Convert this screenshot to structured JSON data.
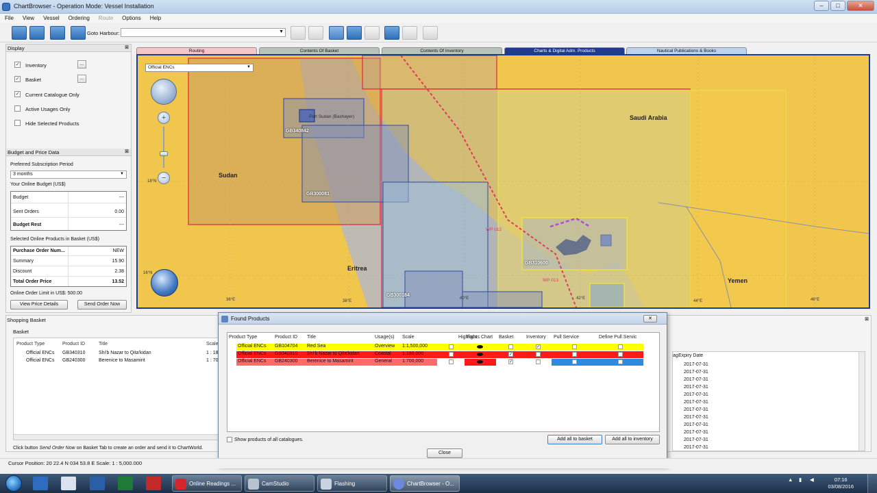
{
  "window": {
    "title": "ChartBrowser - Operation Mode: Vessel Installation",
    "minimize": "–",
    "maximize": "□",
    "close": "✕"
  },
  "menu": [
    "File",
    "View",
    "Vessel",
    "Ordering",
    "Route",
    "Options",
    "Help"
  ],
  "toolbar": {
    "goto_label": "Goto Harbour:",
    "goto_value": ""
  },
  "display_panel": {
    "title": "Display",
    "pin": "⊠",
    "options": [
      {
        "label": "Inventory",
        "checked": true
      },
      {
        "label": "Basket",
        "checked": true
      },
      {
        "label": "Current Catalogue Only",
        "checked": true
      },
      {
        "label": "Active Usages Only",
        "checked": false
      },
      {
        "label": "Hide Selected Products",
        "checked": false
      }
    ],
    "dots": "..."
  },
  "budget_panel": {
    "title": "Budget and Price Data",
    "period_label": "Preferred Subscription Period",
    "period_value": "3 months",
    "budget_label": "Your Online Budget (US$)",
    "budget_rows": [
      {
        "k": "Budget",
        "v": "---"
      },
      {
        "k": "Sent Orders",
        "v": "0.00"
      },
      {
        "k": "Budget Rest",
        "v": "---"
      }
    ],
    "selected_label": "Selected Online Products in Basket (US$)",
    "selected_rows": [
      {
        "k": "Purchase Order Num...",
        "v": "NEW"
      },
      {
        "k": "Summary",
        "v": "15.90"
      },
      {
        "k": "Discount",
        "v": "2.38"
      },
      {
        "k": "Total Order Price",
        "v": "13.52"
      }
    ],
    "limit_label": "Online Order Limit in US$: 500.00",
    "view_price_btn": "View Price Details",
    "send_order_btn": "Send Order Now"
  },
  "tabs": [
    {
      "label": "Routing",
      "color": "#f4c6c6"
    },
    {
      "label": "Contents Of Basket",
      "color": "#b9c4b9"
    },
    {
      "label": "Contents Of Inventory",
      "color": "#b9c4b9"
    },
    {
      "label": "Charts & Digital Adm. Products",
      "color": "#1f3b8c"
    },
    {
      "label": "Nautical Publications & Books",
      "color": "#bcd3ef"
    }
  ],
  "map": {
    "chart_type": "Official ENCs",
    "scale_label_top": "18°N",
    "scale_label_bottom": "16°N",
    "places": [
      {
        "name": "Saudi Arabia"
      },
      {
        "name": "Sudan"
      },
      {
        "name": "Eritrea"
      },
      {
        "name": "Yemen"
      },
      {
        "name": "Port Sudan (Bashayer)"
      }
    ],
    "chart_labels": [
      "GB340842",
      "GB300081",
      "GB310600",
      "GB300184"
    ],
    "waypoints": [
      "WP 012",
      "WP 013"
    ],
    "lon_labels": [
      "36°E",
      "38°E",
      "40°E",
      "42°E",
      "44°E",
      "46°E"
    ]
  },
  "shopping_basket": {
    "title": "Shopping Basket",
    "tab": "Basket",
    "columns": [
      "Product Type",
      "Product ID",
      "Title",
      "Scale"
    ],
    "rows": [
      {
        "type": "Official ENCs",
        "id": "GB340310",
        "title": "Shi'b Nazar to Qita'kidan",
        "scale": "1 : 18"
      },
      {
        "type": "Official ENCs",
        "id": "GB240300",
        "title": "Berenice to Masamirit",
        "scale": "1 : 70"
      }
    ],
    "hint_prefix": "Click button ",
    "hint_emph": "Send Order Now",
    "hint_suffix": " on Basket Tab to create an order and send it to ChartWorld."
  },
  "expiry": {
    "col_ag": "ag",
    "col_expiry": "Expiry Date",
    "dates": [
      "2017-07-31",
      "2017-07-31",
      "2017-07-31",
      "2017-07-31",
      "2017-07-31",
      "2017-07-31",
      "2017-07-31",
      "2017-07-31",
      "2017-07-31",
      "2017-07-31",
      "2017-07-31",
      "2017-07-31",
      "2017-07-31"
    ]
  },
  "found_dialog": {
    "title": "Found Products",
    "columns": [
      "Product Type",
      "Product ID",
      "Title",
      "Usage(s)",
      "Scale",
      "Highlight",
      "Focus Chart",
      "Basket",
      "Inventory",
      "Pull Service",
      "Define Pull Servic"
    ],
    "rows": [
      {
        "type": "Official ENCs",
        "id": "GB104704",
        "title": "Red Sea",
        "usage": "Overview",
        "scale": "1:1,500,000",
        "bg": "#ffff00",
        "basket": false,
        "inventory": true
      },
      {
        "type": "Official ENCs",
        "id": "GB340310",
        "title": "Shi'b Nazar to Qita'kidan",
        "usage": "Coastal",
        "scale": "1:180,000",
        "bg": "#ff1a1a",
        "basket": true,
        "inventory": false
      },
      {
        "type": "Official ENCs",
        "id": "GB240300",
        "title": "Berenice to Masamirit",
        "usage": "General",
        "scale": "1:700,000",
        "bg": "#ff6b6b",
        "basket": true,
        "inventory": false
      }
    ],
    "show_all_label": "Show products of all catalogues.",
    "add_basket_btn": "Add all to basket",
    "add_inventory_btn": "Add all to inventory",
    "close_btn": "Close"
  },
  "status": {
    "cursor": "Cursor Position:  20 22.4 N  034 53.8 E Scale: 1 : 5,000.000"
  },
  "taskbar": {
    "tasks": [
      "Online Readings ...",
      "CamStudio",
      "Flashing",
      "ChartBrowser - O..."
    ],
    "time": "07:16",
    "date": "03/08/2016"
  }
}
